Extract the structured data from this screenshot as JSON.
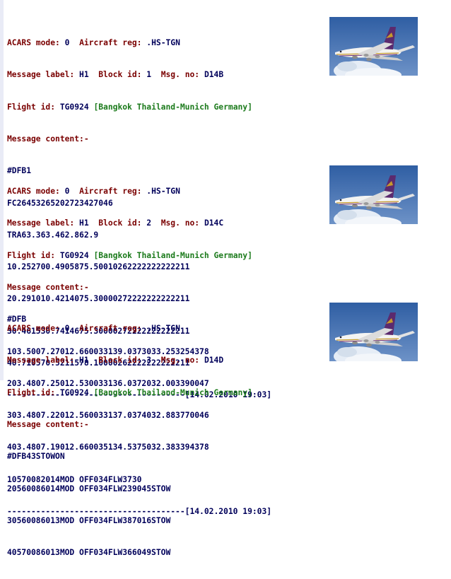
{
  "labels": {
    "acars_mode": "ACARS mode:",
    "aircraft_reg": "Aircraft reg:",
    "message_label": "Message label:",
    "block_id": "Block id:",
    "msg_no": "Msg. no:",
    "flight_id": "Flight id:",
    "message_content": "Message content:-"
  },
  "messages": [
    {
      "acars_mode": "0",
      "aircraft_reg": ".HS-TGN",
      "message_label": "H1",
      "block_id": "1",
      "msg_no": "D14B",
      "flight_id": "TG0924",
      "route": "[Bangkok Thailand-Munich Germany]",
      "content": [
        "#DFB1",
        "FC26453265202723427046",
        "TRA63.363.462.862.9",
        "10.252700.4905875.50010262222222222211",
        "20.291010.4214075.30000272222222222211",
        "30.461530.7414675.30000272222222222211",
        "40.710570.5211578.10000262222222222211"
      ],
      "separator": "-------------------------------------[14.02.2010 19:03]"
    },
    {
      "acars_mode": "0",
      "aircraft_reg": ".HS-TGN",
      "message_label": "H1",
      "block_id": "2",
      "msg_no": "D14C",
      "flight_id": "TG0924",
      "route": "[Bangkok Thailand-Munich Germany]",
      "content": [
        "#DFB",
        "103.5007.27012.660033139.0373033.253254378",
        "203.4807.25012.530033136.0372032.003390047",
        "303.4807.22012.560033137.0374032.883770046",
        "403.4807.19012.660035134.5375032.383394378",
        "10570082014MOD OFF034FLW3730"
      ],
      "separator": "-------------------------------------[14.02.2010 19:03]"
    },
    {
      "acars_mode": "0",
      "aircraft_reg": ".HS-TGN",
      "message_label": "H1",
      "block_id": "3",
      "msg_no": "D14D",
      "flight_id": "TG0924",
      "route": "[Bangkok Thailand-Munich Germany]",
      "content": [
        "#DFB43STOWON",
        "20560086014MOD OFF034FLW239045STOW",
        "30560086013MOD OFF034FLW387016STOW",
        "40570086013MOD OFF034FLW366049STOW"
      ],
      "separator": ""
    }
  ],
  "colors": {
    "label": "#7a0000",
    "value": "#00005a",
    "route": "#1b7a1b",
    "sky": "#3f6aa8",
    "cloud": "#e6edf6"
  },
  "images": [
    {
      "name": "aircraft-photo-1",
      "icon": "boeing-747-thai-airways"
    },
    {
      "name": "aircraft-photo-2",
      "icon": "boeing-747-thai-airways"
    },
    {
      "name": "aircraft-photo-3",
      "icon": "boeing-747-thai-airways"
    }
  ]
}
